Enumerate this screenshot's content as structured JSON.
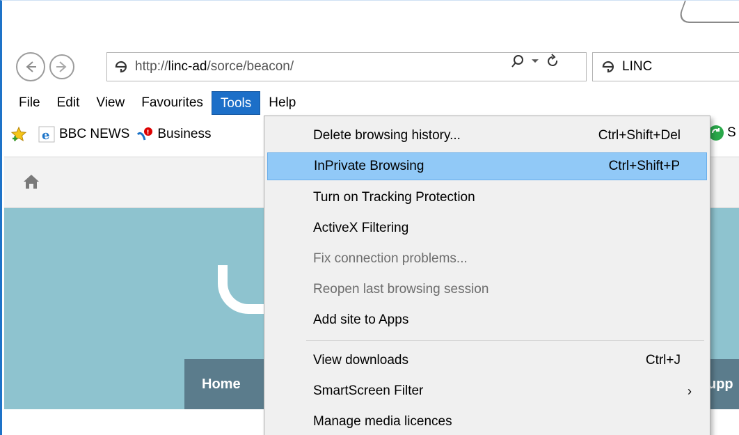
{
  "address": {
    "url_scheme": "http://",
    "url_host": "linc-ad",
    "url_path": "/sorce/beacon/"
  },
  "tab": {
    "title": "LINC"
  },
  "menu": {
    "items": [
      "File",
      "Edit",
      "View",
      "Favourites",
      "Tools",
      "Help"
    ]
  },
  "favourites": {
    "items": [
      "BBC NEWS",
      "Business"
    ],
    "right_item": "S"
  },
  "page": {
    "nav_home": "Home",
    "nav_partial": "upp"
  },
  "tools_menu": {
    "items": [
      {
        "label": "Delete browsing history...",
        "shortcut": "Ctrl+Shift+Del"
      },
      {
        "label": "InPrivate Browsing",
        "shortcut": "Ctrl+Shift+P"
      },
      {
        "label": "Turn on Tracking Protection",
        "shortcut": ""
      },
      {
        "label": "ActiveX Filtering",
        "shortcut": ""
      },
      {
        "label": "Fix connection problems...",
        "shortcut": ""
      },
      {
        "label": "Reopen last browsing session",
        "shortcut": ""
      },
      {
        "label": "Add site to Apps",
        "shortcut": ""
      },
      {
        "label": "View downloads",
        "shortcut": "Ctrl+J"
      },
      {
        "label": "SmartScreen Filter",
        "shortcut": ""
      },
      {
        "label": "Manage media licences",
        "shortcut": ""
      }
    ],
    "submenu_arrow": "›"
  },
  "colors": {
    "menu_active": "#1c6fc8",
    "highlight": "#91c9f7",
    "page_bg": "#8ec3cf",
    "nav_strip": "#5b7c8c"
  }
}
